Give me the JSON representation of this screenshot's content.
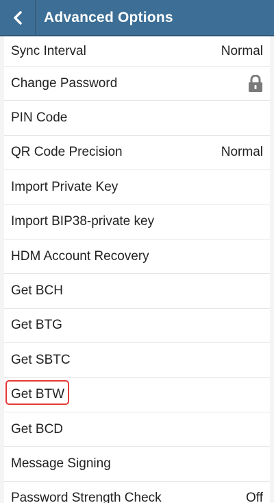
{
  "header": {
    "title": "Advanced Options"
  },
  "colors": {
    "appbar": "#3d6f96",
    "highlight": "#e53935"
  },
  "rows": [
    {
      "label": "Sync Interval",
      "value": "Normal"
    },
    {
      "label": "Change Password",
      "icon": "lock-icon"
    },
    {
      "label": "PIN Code"
    },
    {
      "label": "QR Code Precision",
      "value": "Normal"
    },
    {
      "label": "Import Private Key"
    },
    {
      "label": "Import BIP38-private key"
    },
    {
      "label": "HDM Account Recovery"
    },
    {
      "label": "Get BCH"
    },
    {
      "label": "Get BTG"
    },
    {
      "label": "Get SBTC"
    },
    {
      "label": "Get BTW",
      "highlighted": true
    },
    {
      "label": "Get BCD"
    },
    {
      "label": "Message Signing"
    },
    {
      "label": "Password Strength Check",
      "value": "Off"
    }
  ]
}
